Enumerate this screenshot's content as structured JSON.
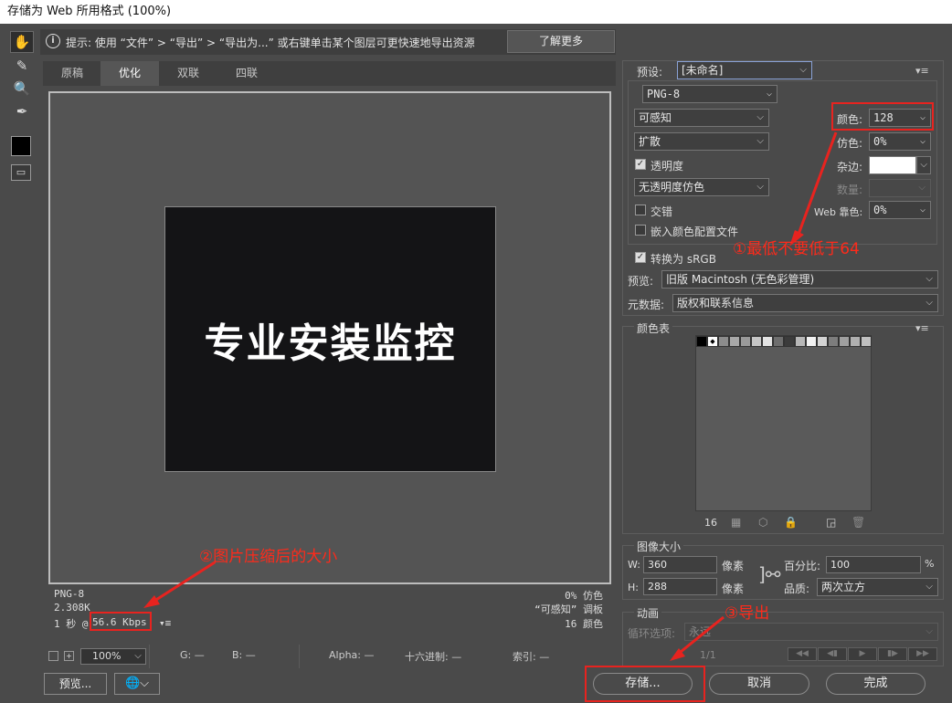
{
  "window": {
    "title": "存储为 Web 所用格式 (100%)"
  },
  "tools": [
    "hand-icon",
    "slice-select-icon",
    "zoom-icon",
    "eyedropper-icon"
  ],
  "hint": {
    "icon": "i",
    "text": "提示: 使用 “文件” > “导出” > “导出为...” 或右键单击某个图层可更快速地导出资源",
    "learn_more": "了解更多"
  },
  "tabs": [
    {
      "label": "原稿"
    },
    {
      "label": "优化"
    },
    {
      "label": "双联"
    },
    {
      "label": "四联"
    }
  ],
  "image": {
    "text": "专业安装监控"
  },
  "info": {
    "format": "PNG-8",
    "size": "2.308K",
    "time_prefix": "1 秒 @",
    "speed": "56.6 Kbps",
    "dither": "0% 仿色",
    "palette": "“可感知” 调板",
    "colors": "16 颜色"
  },
  "annotations": {
    "note1": "①最低不要低于64",
    "note2": "②图片压缩后的大小",
    "note3": "③导出"
  },
  "status": {
    "zoom": "100%",
    "g": "G: —",
    "b": "B: —",
    "alpha": "Alpha: —",
    "hex": "十六进制: —",
    "index": "索引: —"
  },
  "buttons": {
    "preview": "预览...",
    "save": "存储...",
    "cancel": "取消",
    "done": "完成"
  },
  "settings": {
    "preset_label": "预设:",
    "preset_value": "[未命名]",
    "format": "PNG-8",
    "reduction": "可感知",
    "dither_algo": "扩散",
    "colors_label": "颜色:",
    "colors_value": "128",
    "dither_label": "仿色:",
    "dither_value": "0%",
    "transparency": "透明度",
    "matte_label": "杂边:",
    "trans_dither": "无透明度仿色",
    "amount_label": "数量:",
    "interlaced": "交错",
    "web_snap_label": "Web 靠色:",
    "web_snap_value": "0%",
    "embed_profile": "嵌入颜色配置文件",
    "convert_srgb": "转换为 sRGB",
    "preview_label": "预览:",
    "preview_value": "旧版 Macintosh (无色彩管理)",
    "metadata_label": "元数据:",
    "metadata_value": "版权和联系信息"
  },
  "color_table": {
    "title": "颜色表",
    "count": "16",
    "swatches": [
      "#000000",
      "#ffffff",
      "#8c8c8c",
      "#a9a9a9",
      "#9a9a9a",
      "#c6c6c6",
      "#e4e4e4",
      "#6e6e6e",
      "#3b3b3b",
      "#b7b7b7",
      "#f2f2f2",
      "#d4d4d4",
      "#7d7d7d",
      "#a0a0a0",
      "#b0b0b0",
      "#c0c0c0"
    ]
  },
  "image_size": {
    "title": "图像大小",
    "w_label": "W:",
    "w_value": "360",
    "h_label": "H:",
    "h_value": "288",
    "unit": "像素",
    "percent_label": "百分比:",
    "percent_value": "100",
    "percent_unit": "%",
    "quality_label": "品质:",
    "quality_value": "两次立方"
  },
  "animation": {
    "title": "动画",
    "loop_label": "循环选项:",
    "loop_value": "永远",
    "frame": "1/1"
  },
  "colors": {
    "accent_red": "#e8231f"
  }
}
